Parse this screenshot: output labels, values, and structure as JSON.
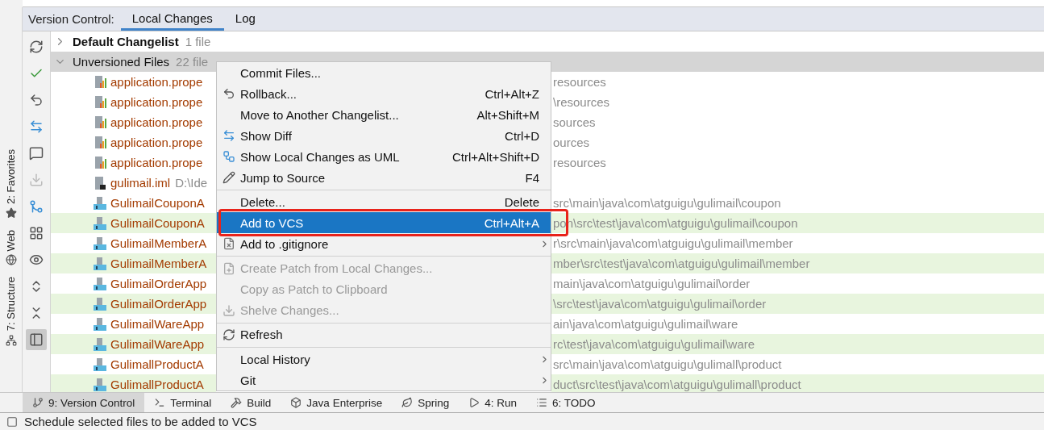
{
  "header": {
    "label": "Version Control:",
    "tabs": [
      {
        "label": "Local Changes",
        "selected": true
      },
      {
        "label": "Log",
        "selected": false
      }
    ]
  },
  "left_stripe": [
    {
      "label": "2: Favorites"
    },
    {
      "label": "Web"
    },
    {
      "label": "7: Structure"
    }
  ],
  "tree": {
    "groups": [
      {
        "name": "Default Changelist",
        "count": "1 file",
        "expanded": false,
        "selected": false
      },
      {
        "name": "Unversioned Files",
        "count": "22 file",
        "expanded": true,
        "selected": true
      }
    ],
    "rows": [
      {
        "kind": "properties",
        "name": "application.prope",
        "location": "resources",
        "highlighted": false
      },
      {
        "kind": "properties",
        "name": "application.prope",
        "location": "\\resources",
        "highlighted": false
      },
      {
        "kind": "properties",
        "name": "application.prope",
        "location": "sources",
        "highlighted": false
      },
      {
        "kind": "properties",
        "name": "application.prope",
        "location": "ources",
        "highlighted": false
      },
      {
        "kind": "properties",
        "name": "application.prope",
        "location": "resources",
        "highlighted": false
      },
      {
        "kind": "iml",
        "name": "gulimail.iml",
        "detail": "D:\\Ide",
        "highlighted": false
      },
      {
        "kind": "java",
        "name": "GulimailCouponA",
        "location": "src\\main\\java\\com\\atguigu\\gulimail\\coupon",
        "highlighted": false
      },
      {
        "kind": "java",
        "name": "GulimailCouponA",
        "location": "pon\\src\\test\\java\\com\\atguigu\\gulimail\\coupon",
        "highlighted": true
      },
      {
        "kind": "java",
        "name": "GulimailMemberA",
        "location": "r\\src\\main\\java\\com\\atguigu\\gulimail\\member",
        "highlighted": false
      },
      {
        "kind": "java",
        "name": "GulimailMemberA",
        "location": "mber\\src\\test\\java\\com\\atguigu\\gulimail\\member",
        "highlighted": true
      },
      {
        "kind": "java",
        "name": "GulimailOrderApp",
        "location": "main\\java\\com\\atguigu\\gulimail\\order",
        "highlighted": false
      },
      {
        "kind": "java",
        "name": "GulimailOrderApp",
        "location": "\\src\\test\\java\\com\\atguigu\\gulimail\\order",
        "highlighted": true
      },
      {
        "kind": "java",
        "name": "GulimailWareApp",
        "location": "ain\\java\\com\\atguigu\\gulimail\\ware",
        "highlighted": false
      },
      {
        "kind": "java",
        "name": "GulimailWareApp",
        "location": "rc\\test\\java\\com\\atguigu\\gulimail\\ware",
        "highlighted": true
      },
      {
        "kind": "java",
        "name": "GulimallProductA",
        "location": "src\\main\\java\\com\\atguigu\\gulimall\\product",
        "highlighted": false
      },
      {
        "kind": "java",
        "name": "GulimallProductA",
        "location": "duct\\src\\test\\java\\com\\atguigu\\gulimall\\product",
        "highlighted": true
      }
    ]
  },
  "context_menu": [
    {
      "kind": "item",
      "label": "Commit Files...",
      "disabled": false,
      "selected": false,
      "submenu": false
    },
    {
      "kind": "item",
      "label": "Rollback...",
      "shortcut": "Ctrl+Alt+Z",
      "disabled": false,
      "selected": false,
      "submenu": false
    },
    {
      "kind": "item",
      "label": "Move to Another Changelist...",
      "shortcut": "Alt+Shift+M",
      "disabled": false,
      "selected": false,
      "submenu": false
    },
    {
      "kind": "item",
      "label": "Show Diff",
      "shortcut": "Ctrl+D",
      "disabled": false,
      "selected": false,
      "submenu": false
    },
    {
      "kind": "item",
      "label": "Show Local Changes as UML",
      "shortcut": "Ctrl+Alt+Shift+D",
      "disabled": false,
      "selected": false,
      "submenu": false
    },
    {
      "kind": "item",
      "label": "Jump to Source",
      "shortcut": "F4",
      "disabled": false,
      "selected": false,
      "submenu": false
    },
    {
      "kind": "separator"
    },
    {
      "kind": "item",
      "label": "Delete...",
      "shortcut": "Delete",
      "disabled": false,
      "selected": false,
      "submenu": false
    },
    {
      "kind": "item",
      "label": "Add to VCS",
      "shortcut": "Ctrl+Alt+A",
      "disabled": false,
      "selected": true,
      "submenu": false,
      "annotated": true
    },
    {
      "kind": "item",
      "label": "Add to .gitignore",
      "disabled": false,
      "selected": false,
      "submenu": true
    },
    {
      "kind": "separator"
    },
    {
      "kind": "item",
      "label": "Create Patch from Local Changes...",
      "disabled": true,
      "selected": false,
      "submenu": false
    },
    {
      "kind": "item",
      "label": "Copy as Patch to Clipboard",
      "disabled": true,
      "selected": false,
      "submenu": false
    },
    {
      "kind": "item",
      "label": "Shelve Changes...",
      "disabled": true,
      "selected": false,
      "submenu": false
    },
    {
      "kind": "separator"
    },
    {
      "kind": "item",
      "label": "Refresh",
      "disabled": false,
      "selected": false,
      "submenu": false
    },
    {
      "kind": "separator"
    },
    {
      "kind": "item",
      "label": "Local History",
      "disabled": false,
      "selected": false,
      "submenu": true
    },
    {
      "kind": "item",
      "label": "Git",
      "disabled": false,
      "selected": false,
      "submenu": true
    }
  ],
  "bottom_tabs": [
    {
      "label": "9: Version Control",
      "selected": true
    },
    {
      "label": "Terminal",
      "selected": false
    },
    {
      "label": "Build",
      "selected": false
    },
    {
      "label": "Java Enterprise",
      "selected": false
    },
    {
      "label": "Spring",
      "selected": false
    },
    {
      "label": "4: Run",
      "selected": false
    },
    {
      "label": "6: TODO",
      "selected": false
    }
  ],
  "status_bar": {
    "message": "Schedule selected files to be added to VCS"
  }
}
